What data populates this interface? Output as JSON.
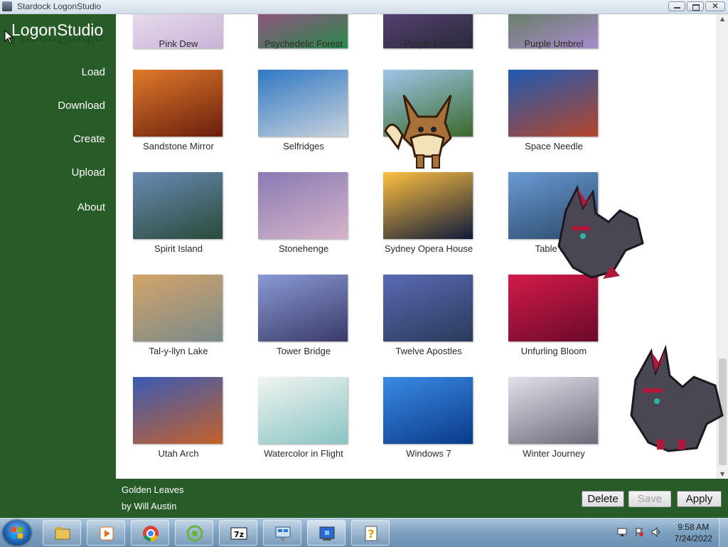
{
  "window": {
    "title": "Stardock LogonStudio"
  },
  "sidebar": {
    "logo": "LogonStudio",
    "items": [
      {
        "label": "Load"
      },
      {
        "label": "Download"
      },
      {
        "label": "Create"
      },
      {
        "label": "Upload"
      },
      {
        "label": "About"
      }
    ]
  },
  "gallery": {
    "items": [
      {
        "caption": "Pink Dew",
        "colors": [
          "#f4eef6",
          "#c9b2d6"
        ]
      },
      {
        "caption": "Psychedelic Forest",
        "colors": [
          "#c03a9a",
          "#2a8a4a"
        ]
      },
      {
        "caption": "Purple Field",
        "colors": [
          "#6a4a8a",
          "#2a2a3a"
        ]
      },
      {
        "caption": "Purple Umbrel",
        "colors": [
          "#4a7a3a",
          "#a88acb"
        ]
      },
      {
        "caption": "Sandstone Mirror",
        "colors": [
          "#e07a2a",
          "#6a1e0e"
        ]
      },
      {
        "caption": "Selfridges",
        "colors": [
          "#2f78c4",
          "#c8d2dc"
        ]
      },
      {
        "caption": "",
        "colors": [
          "#9ec6ea",
          "#3a6a2a"
        ]
      },
      {
        "caption": "Space Needle",
        "colors": [
          "#1e5ab4",
          "#b4462a"
        ]
      },
      {
        "caption": "Spirit Island",
        "colors": [
          "#6a8ab4",
          "#2a4a3a"
        ]
      },
      {
        "caption": "Stonehenge",
        "colors": [
          "#8a7ab4",
          "#d4b4c8"
        ]
      },
      {
        "caption": "Sydney Opera House",
        "colors": [
          "#ffc040",
          "#0e1a3a"
        ]
      },
      {
        "caption": "Table Mo",
        "colors": [
          "#6a9ad4",
          "#2a4a6a"
        ]
      },
      {
        "caption": "Tal-y-llyn Lake",
        "colors": [
          "#d4a46a",
          "#7a8a8a"
        ]
      },
      {
        "caption": "Tower Bridge",
        "colors": [
          "#8a9ad4",
          "#3a3a6a"
        ]
      },
      {
        "caption": "Twelve Apostles",
        "colors": [
          "#5a6ab4",
          "#2a3a5a"
        ]
      },
      {
        "caption": "Unfurling Bloom",
        "colors": [
          "#d41a4a",
          "#6a0a2a"
        ]
      },
      {
        "caption": "Utah Arch",
        "colors": [
          "#3a5ab4",
          "#c4622a"
        ]
      },
      {
        "caption": "Watercolor in Flight",
        "colors": [
          "#f0f4f0",
          "#8ac4c4"
        ]
      },
      {
        "caption": "Windows 7",
        "colors": [
          "#3a8ae4",
          "#0a3a8a"
        ]
      },
      {
        "caption": "Winter Journey",
        "colors": [
          "#e4e0ea",
          "#6a6a7a"
        ]
      }
    ]
  },
  "selected": {
    "title": "Golden Leaves",
    "author": "by Will Austin"
  },
  "buttons": {
    "delete": "Delete",
    "save": "Save",
    "apply": "Apply"
  },
  "taskbar": {
    "apps": [
      "explorer-icon",
      "media-player-icon",
      "chrome-icon",
      "refresh-app-icon",
      "7zip-icon",
      "network-icon",
      "logonstudio-icon",
      "help-icon"
    ],
    "time": "9:58 AM",
    "date": "7/24/2022"
  },
  "colors": {
    "sidebar": "#275c29",
    "content": "#ffffff"
  }
}
